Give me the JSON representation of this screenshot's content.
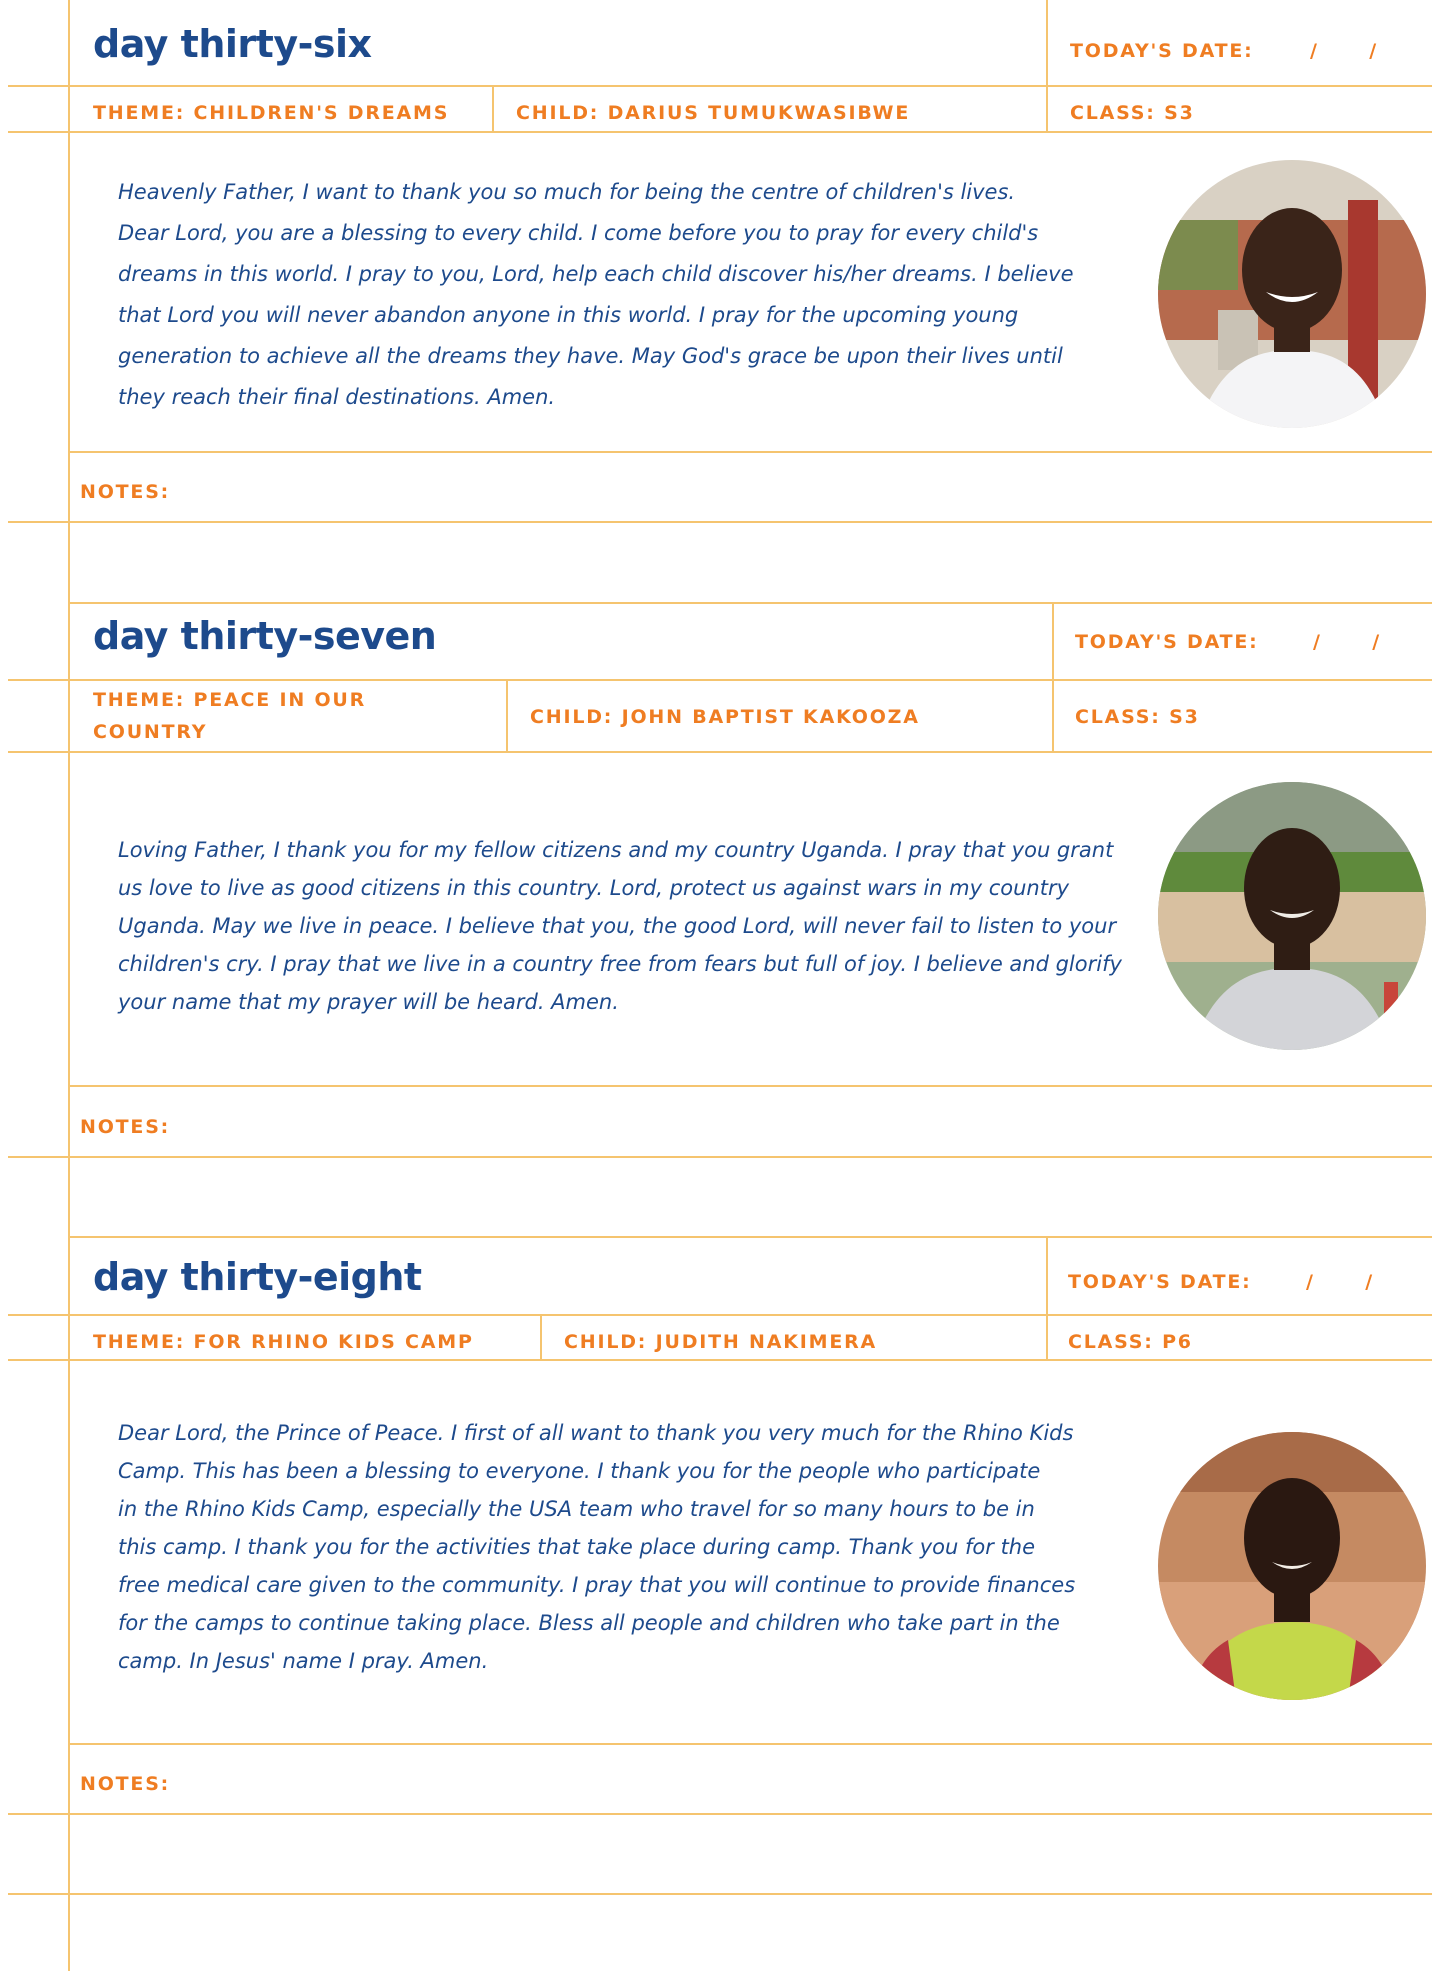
{
  "entries": [
    {
      "title": "day thirty-six",
      "date_label": "TODAY'S DATE:",
      "date_slashes": "/      /",
      "theme": "THEME: CHILDREN'S DREAMS",
      "child": "CHILD: DARIUS TUMUKWASIBWE",
      "class": "CLASS: S3",
      "prayer_lines": [
        "Heavenly Father, I want to thank you so much for being the centre of children's lives.",
        "Dear Lord, you are a blessing to every child. I come before you to pray for every child's",
        "dreams in this world. I pray to you, Lord, help each child discover his/her dreams. I believe",
        "that Lord you will never abandon anyone in this world. I pray for the upcoming young",
        "generation to achieve all the dreams they have. May God's grace be upon their lives until",
        "they reach their final destinations. Amen."
      ],
      "notes_label": "NOTES:"
    },
    {
      "title": "day thirty-seven",
      "date_label": "TODAY'S DATE:",
      "date_slashes": "/      /",
      "theme": "THEME: PEACE IN OUR COUNTRY",
      "child": "CHILD: JOHN BAPTIST KAKOOZA",
      "class": "CLASS: S3",
      "prayer_lines": [
        "Loving Father, I thank you for my fellow citizens and my country Uganda. I pray that you grant",
        "us love to live as good citizens in this country. Lord, protect us against wars in my country",
        "Uganda. May we live in peace. I believe that you, the good Lord, will never fail to listen to your",
        "children's cry. I pray that we live in a country free from fears but full of joy. I believe and glorify",
        "your name that my prayer will be heard. Amen."
      ],
      "notes_label": "NOTES:"
    },
    {
      "title": "day thirty-eight",
      "date_label": "TODAY'S DATE:",
      "date_slashes": "/      /",
      "theme": "THEME: FOR RHINO KIDS CAMP",
      "child": "CHILD: JUDITH NAKIMERA",
      "class": "CLASS: P6",
      "prayer_lines": [
        "Dear Lord, the Prince of Peace. I first of all want to thank you very much for the Rhino Kids",
        "Camp. This has been a blessing to everyone. I thank you for the people who participate",
        "in the Rhino Kids Camp, especially the USA team who travel for so many hours to be in",
        "this camp. I thank you for the activities that take place during camp. Thank you for the",
        "free medical care given to the community. I pray that you will continue to provide finances",
        "for the camps to continue taking place. Bless all people and children who take part in the",
        "camp. In Jesus' name I pray. Amen."
      ],
      "notes_label": "NOTES:"
    }
  ],
  "colors": {
    "title_blue": "#1d4a8c",
    "accent_orange": "#ef7d22",
    "rule_line": "#f5c46f"
  }
}
